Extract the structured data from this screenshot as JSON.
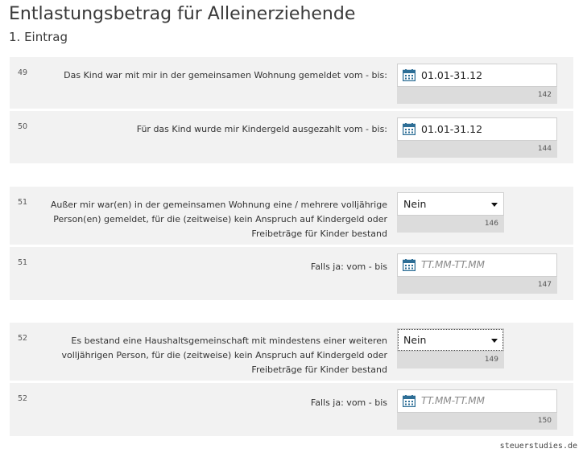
{
  "page": {
    "title": "Entlastungsbetrag für Alleinerziehende",
    "subtitle": "1. Eintrag"
  },
  "rows": [
    {
      "num": "49",
      "label": "Das Kind war mit mir in der gemeinsamen Wohnung gemeldet vom - bis:",
      "type": "date",
      "value": "01.01-31.12",
      "placeholder": "",
      "code": "142"
    },
    {
      "num": "50",
      "label": "Für das Kind wurde mir Kindergeld ausgezahlt vom - bis:",
      "type": "date",
      "value": "01.01-31.12",
      "placeholder": "",
      "code": "144"
    },
    {
      "num": "51",
      "label": "Außer mir war(en) in der gemeinsamen Wohnung eine / mehrere volljährige Person(en) gemeldet, für die (zeitweise) kein Anspruch auf Kindergeld oder Freibeträge für Kinder bestand",
      "type": "select",
      "value": "Nein",
      "code": "146"
    },
    {
      "num": "51",
      "label": "Falls ja: vom - bis",
      "type": "date",
      "value": "",
      "placeholder": "TT.MM-TT.MM",
      "code": "147"
    },
    {
      "num": "52",
      "label": "Es bestand eine Haushaltsgemeinschaft mit mindestens einer weiteren volljährigen Person, für die (zeitweise) kein Anspruch auf Kindergeld oder Freibeträge für Kinder bestand",
      "type": "select",
      "value": "Nein",
      "code": "149"
    },
    {
      "num": "52",
      "label": "Falls ja: vom - bis",
      "type": "date",
      "value": "",
      "placeholder": "TT.MM-TT.MM",
      "code": "150"
    }
  ],
  "icons": {
    "date_field": "calendar-icon",
    "select_field": "caret-down-icon"
  },
  "colors": {
    "row_bg": "#f2f2f2",
    "code_bg": "#dcdcdc",
    "calendar_icon": "#2d6e96"
  },
  "watermark": "steuerstudies.de"
}
